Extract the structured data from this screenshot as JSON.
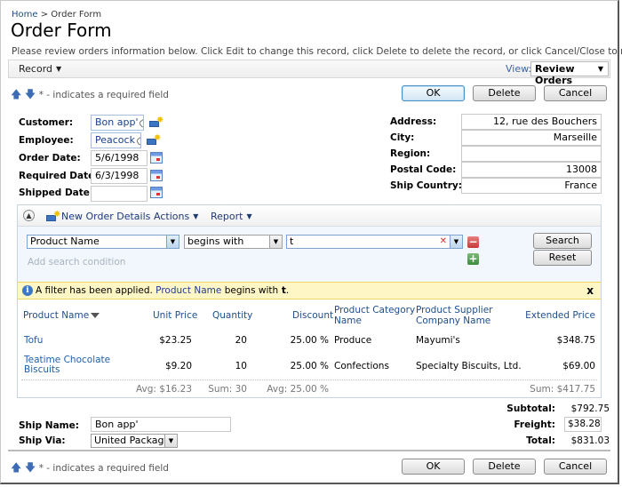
{
  "breadcrumb": {
    "home": "Home",
    "separator": ">",
    "current": "Order Form"
  },
  "page_title": "Order Form",
  "description": "Please review orders information below. Click Edit to change this record, click Delete to delete the record, or click Cancel/Close to return back.",
  "toolbar": {
    "record_label": "Record",
    "view_label": "View:",
    "view_value": "Review Orders"
  },
  "required_note": "* - indicates a required field",
  "buttons": {
    "ok": "OK",
    "delete": "Delete",
    "cancel": "Cancel"
  },
  "left_fields": {
    "customer": {
      "label": "Customer:",
      "value": "Bon app'"
    },
    "employee": {
      "label": "Employee:",
      "value": "Peacock"
    },
    "order_date": {
      "label": "Order Date:",
      "value": "5/6/1998"
    },
    "required_date": {
      "label": "Required Date:",
      "value": "6/3/1998"
    },
    "shipped_date": {
      "label": "Shipped Date:",
      "value": ""
    }
  },
  "right_fields": {
    "address": {
      "label": "Address:",
      "value": "12, rue des Bouchers"
    },
    "city": {
      "label": "City:",
      "value": "Marseille"
    },
    "region": {
      "label": "Region:",
      "value": ""
    },
    "postal_code": {
      "label": "Postal Code:",
      "value": "13008"
    },
    "ship_country": {
      "label": "Ship Country:",
      "value": "France"
    }
  },
  "grid": {
    "toolbar": {
      "new_label": "New Order Details",
      "actions_label": "Actions",
      "report_label": "Report"
    },
    "search": {
      "field": "Product Name",
      "operator": "begins with",
      "value": "t",
      "add_condition": "Add search condition",
      "search_button": "Search",
      "reset_button": "Reset"
    },
    "filter_message": {
      "prefix": "A filter has been applied.",
      "field": "Product Name",
      "middle": "begins with",
      "value": "t",
      "suffix": ".",
      "close": "x"
    },
    "columns": {
      "product_name": "Product Name",
      "unit_price": "Unit Price",
      "quantity": "Quantity",
      "discount": "Discount",
      "category_1": "Product Category",
      "category_2": "Name",
      "supplier_1": "Product Supplier",
      "supplier_2": "Company Name",
      "extended_price": "Extended Price"
    },
    "rows": [
      {
        "product_name": "Tofu",
        "product_name_2": "",
        "unit_price": "$23.25",
        "quantity": "20",
        "discount": "25.00 %",
        "category": "Produce",
        "supplier": "Mayumi's",
        "extended_price": "$348.75"
      },
      {
        "product_name": "Teatime Chocolate",
        "product_name_2": "Biscuits",
        "unit_price": "$9.20",
        "quantity": "10",
        "discount": "25.00 %",
        "category": "Confections",
        "supplier": "Specialty Biscuits, Ltd.",
        "extended_price": "$69.00"
      }
    ],
    "aggregates": {
      "unit_price": "Avg: $16.23",
      "quantity": "Sum: 30",
      "discount": "Avg: 25.00 %",
      "extended_price": "Sum: $417.75"
    }
  },
  "ship": {
    "name": {
      "label": "Ship Name:",
      "value": "Bon app'"
    },
    "via": {
      "label": "Ship Via:",
      "value": "United Package"
    }
  },
  "totals": {
    "subtotal": {
      "label": "Subtotal:",
      "value": "$792.75"
    },
    "freight": {
      "label": "Freight:",
      "value": "$38.28"
    },
    "total": {
      "label": "Total:",
      "value": "$831.03"
    }
  }
}
